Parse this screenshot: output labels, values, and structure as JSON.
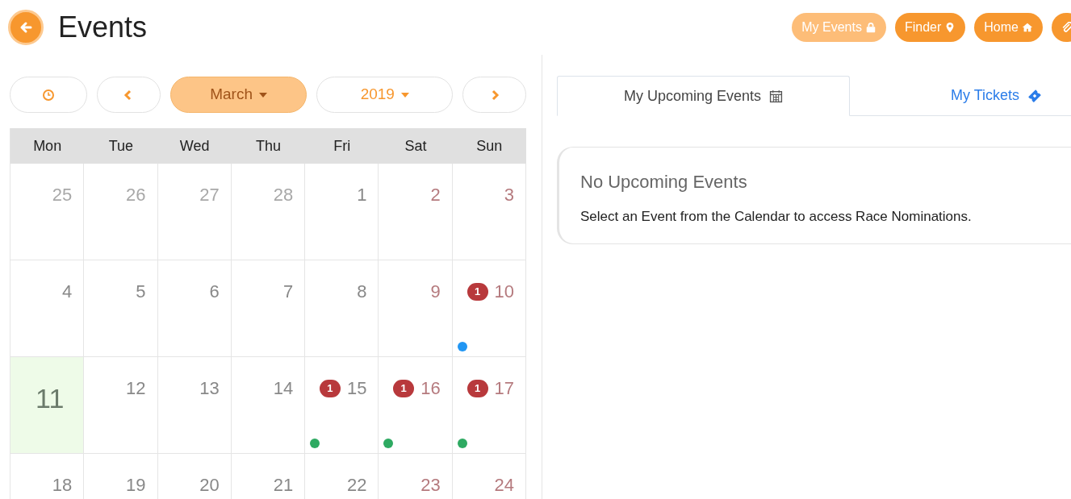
{
  "title": "Events",
  "top_buttons": [
    {
      "label": "My Events",
      "active": true
    },
    {
      "label": "Finder",
      "active": false
    },
    {
      "label": "Home",
      "active": false
    },
    {
      "active": false
    }
  ],
  "toolbar": [
    {
      "kind": "today"
    },
    {
      "kind": "prev"
    },
    {
      "kind": "dropdown",
      "label": "March",
      "selected": true
    },
    {
      "kind": "dropdown",
      "label": "2019",
      "selected": false
    },
    {
      "kind": "next"
    }
  ],
  "weekdays": [
    "Mon",
    "Tue",
    "Wed",
    "Thu",
    "Fri",
    "Sat",
    "Sun"
  ],
  "weeks": [
    [
      {
        "day": "25",
        "kind": "other"
      },
      {
        "day": "26",
        "kind": "other"
      },
      {
        "day": "27",
        "kind": "other"
      },
      {
        "day": "28",
        "kind": "other"
      },
      {
        "day": "1",
        "kind": "weekday"
      },
      {
        "day": "2",
        "kind": "weekend"
      },
      {
        "day": "3",
        "kind": "weekend"
      }
    ],
    [
      {
        "day": "4",
        "kind": "weekday"
      },
      {
        "day": "5",
        "kind": "weekday"
      },
      {
        "day": "6",
        "kind": "weekday"
      },
      {
        "day": "7",
        "kind": "weekday"
      },
      {
        "day": "8",
        "kind": "weekday"
      },
      {
        "day": "9",
        "kind": "weekend"
      },
      {
        "day": "10",
        "kind": "weekend",
        "badge": "1",
        "color": "#2196f3"
      }
    ],
    [
      {
        "day": "11",
        "kind": "today"
      },
      {
        "day": "12",
        "kind": "weekday"
      },
      {
        "day": "13",
        "kind": "weekday"
      },
      {
        "day": "14",
        "kind": "weekday"
      },
      {
        "day": "15",
        "kind": "weekday",
        "badge": "1",
        "color": "#2eaa62"
      },
      {
        "day": "16",
        "kind": "weekend",
        "badge": "1",
        "color": "#2eaa62"
      },
      {
        "day": "17",
        "kind": "weekend",
        "badge": "1",
        "color": "#2eaa62"
      }
    ],
    [
      {
        "day": "18",
        "kind": "weekday"
      },
      {
        "day": "19",
        "kind": "weekday"
      },
      {
        "day": "20",
        "kind": "weekday"
      },
      {
        "day": "21",
        "kind": "weekday"
      },
      {
        "day": "22",
        "kind": "weekday"
      },
      {
        "day": "23",
        "kind": "weekend"
      },
      {
        "day": "24",
        "kind": "weekend"
      }
    ]
  ],
  "tabs": [
    {
      "label": "My Upcoming Events",
      "selected": true
    },
    {
      "label": "My Tickets",
      "selected": false
    }
  ],
  "panel": {
    "heading": "No Upcoming Events",
    "text": "Select an Event from the Calendar to access Race Nominations."
  }
}
